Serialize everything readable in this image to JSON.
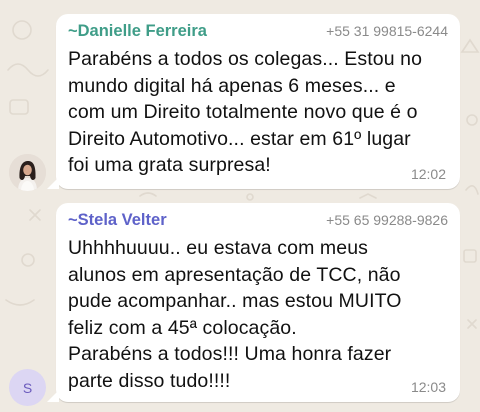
{
  "colors": {
    "chat_background": "#efeae2",
    "bubble": "#ffffff",
    "sender_danielle": "#3f9d88",
    "sender_stela": "#5e62c9",
    "secondary_text": "#8a8a8a"
  },
  "messages": [
    {
      "avatar": "profile-photo",
      "sender_prefix": "~",
      "sender": "Danielle Ferreira",
      "phone": "+55 31 99815-6244",
      "text": "Parabéns a todos os colegas... Estou no\nmundo digital há apenas 6 meses... e\ncom um Direito totalmente novo que é o\nDireito Automotivo... estar em 61º lugar\nfoi uma grata surpresa!",
      "time": "12:02"
    },
    {
      "avatar_initial": "S",
      "sender_prefix": "~",
      "sender": "Stela Velter",
      "phone": "+55 65 99288-9826",
      "text": "Uhhhhuuuu.. eu estava com meus\nalunos em apresentação de TCC, não\npude acompanhar.. mas estou MUITO\nfeliz com a 45ª colocação.\nParabéns a todos!!! Uma honra fazer\nparte disso tudo!!!!",
      "time": "12:03"
    }
  ]
}
